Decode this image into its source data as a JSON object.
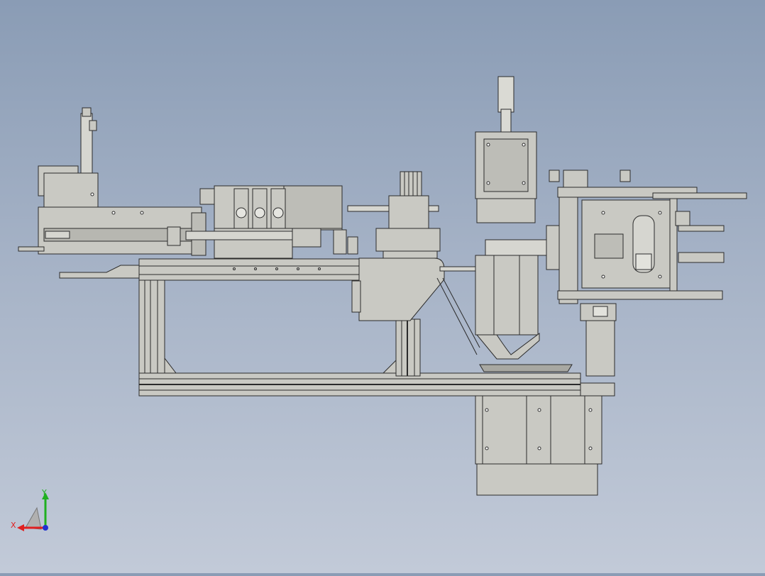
{
  "app": {
    "view": "front",
    "colors": {
      "background_top": "#8a9cb5",
      "background_bottom": "#c2cad8",
      "part_fill": "#c9c9c3",
      "part_fill_dark": "#b7b7b1",
      "edge": "#2b2b2b"
    }
  },
  "triad": {
    "x_label": "X",
    "y_label": "Y",
    "x_color": "#e02020",
    "y_color": "#20b020",
    "z_color": "#2030d0"
  }
}
